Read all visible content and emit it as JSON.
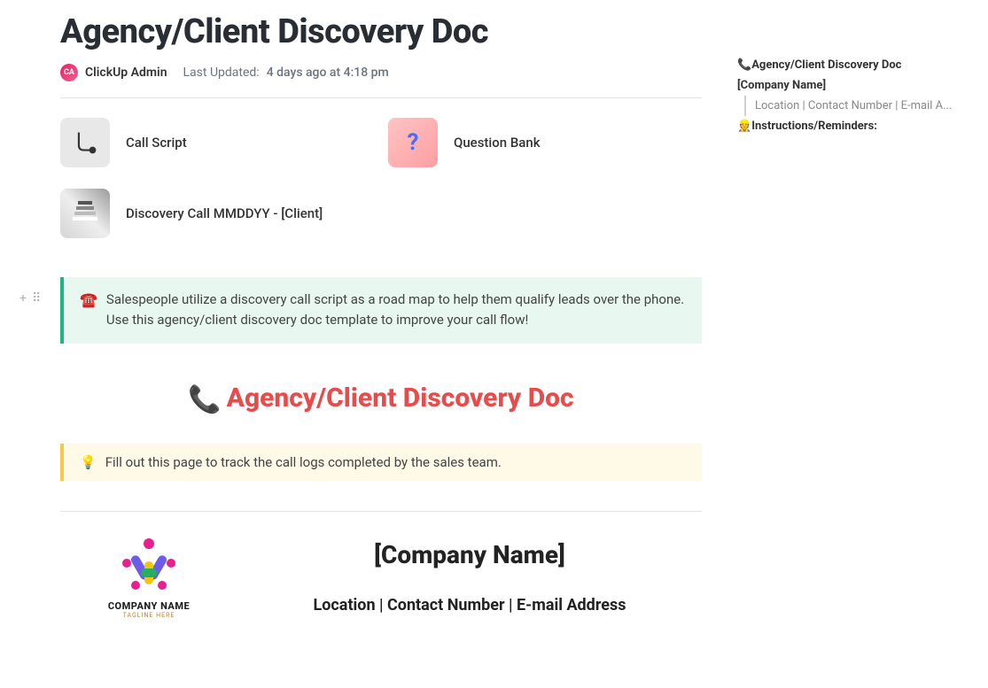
{
  "header": {
    "title": "Agency/Client Discovery Doc",
    "avatar_initials": "CA",
    "author": "ClickUp Admin",
    "updated_label": "Last Updated:",
    "updated_time": "4 days ago at 4:18 pm"
  },
  "cards": [
    {
      "label": "Call Script",
      "icon": "📞"
    },
    {
      "label": "Question Bank",
      "icon": "?"
    },
    {
      "label": "Discovery Call MMDDYY - [Client]",
      "icon": "📚"
    }
  ],
  "callout_green": {
    "icon": "☎️",
    "text": "Salespeople utilize a discovery call script as a road map to help them qualify leads over the phone. Use this agency/client discovery doc template to improve your call flow!"
  },
  "heading_red": {
    "icon": "📞",
    "text": "Agency/Client Discovery Doc"
  },
  "callout_yellow": {
    "icon": "💡",
    "text": "Fill out this page to track the call logs completed by the sales team."
  },
  "company": {
    "logo_name": "COMPANY NAME",
    "logo_tagline": "TAGLINE HERE",
    "name": "[Company Name]",
    "subline": "Location | Contact Number | E-mail Address"
  },
  "outline": [
    {
      "icon": "📞",
      "label": "Agency/Client Discovery Doc",
      "bold": true
    },
    {
      "icon": "",
      "label": "[Company Name]",
      "bold": true
    },
    {
      "icon": "",
      "label": "Location | Contact Number | E-mail A...",
      "indent": true
    },
    {
      "icon": "👷",
      "label": "Instructions/Reminders:",
      "bold": true
    }
  ],
  "gutter": {
    "add": "+",
    "drag": "⠿"
  }
}
